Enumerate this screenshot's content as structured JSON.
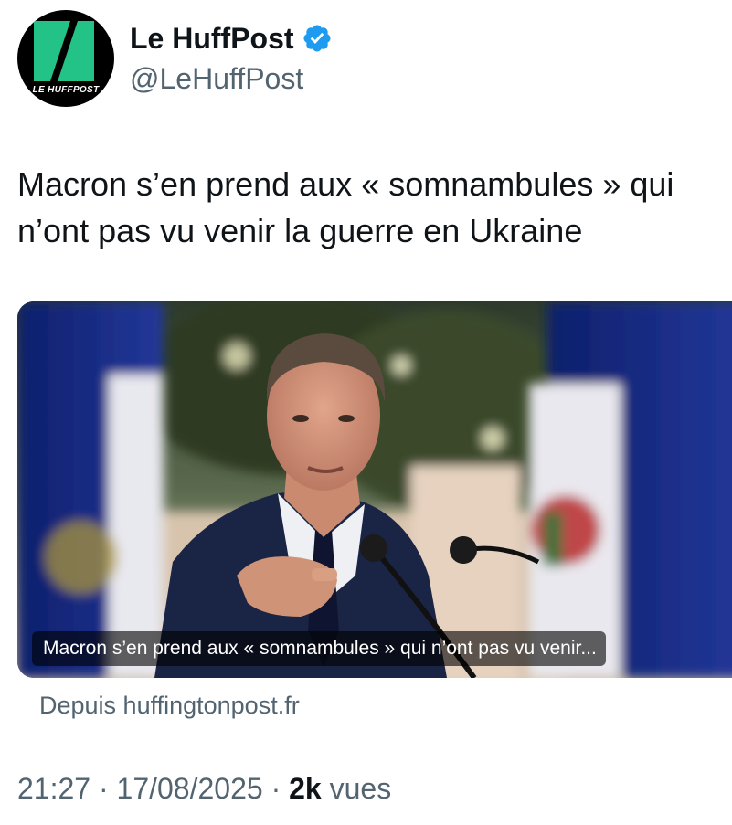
{
  "account": {
    "display_name": "Le HuffPost",
    "handle": "@LeHuffPost",
    "avatar_logo_text": "LE HUFFPOST",
    "verified": true,
    "avatar_brand_color": "#23c287"
  },
  "tweet": {
    "text": "Macron s’en prend aux « somnambules » qui n’ont pas vu venir la guerre en Ukraine"
  },
  "card": {
    "caption": "Macron s’en prend aux « somnambules » qui n’ont pas vu venir...",
    "source": "Depuis huffingtonpost.fr"
  },
  "meta": {
    "time": "21:27",
    "separator": " · ",
    "date": "17/08/2025",
    "views_count": "2k",
    "views_label": "vues"
  },
  "colors": {
    "text_primary": "#0f1419",
    "text_secondary": "#536471",
    "verified_blue": "#1d9bf0"
  }
}
